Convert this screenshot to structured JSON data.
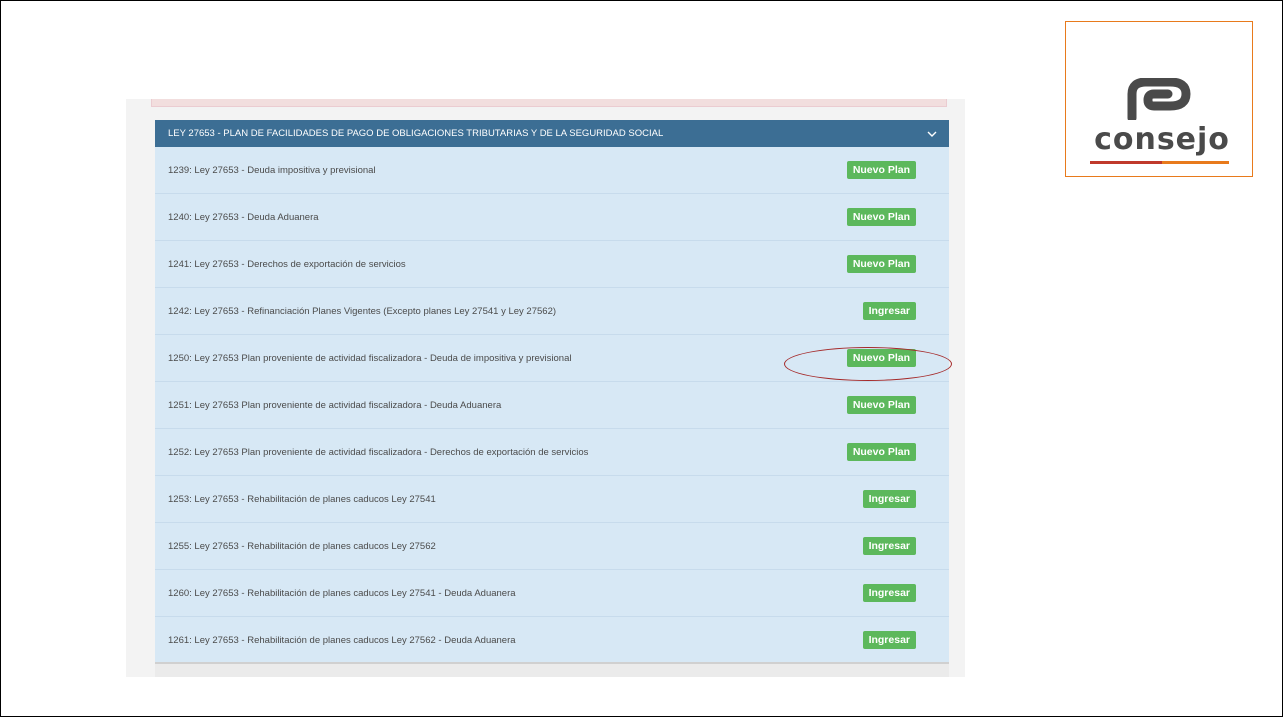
{
  "panel": {
    "title": "LEY 27653 - PLAN DE FACILIDADES DE PAGO DE OBLIGACIONES TRIBUTARIAS Y DE LA SEGURIDAD SOCIAL",
    "toggle_icon": "chevron-down-icon"
  },
  "rows": [
    {
      "label": "1239: Ley 27653 - Deuda impositiva y previsional",
      "action": "Nuevo Plan"
    },
    {
      "label": "1240: Ley 27653 - Deuda Aduanera",
      "action": "Nuevo Plan"
    },
    {
      "label": "1241: Ley 27653 - Derechos de exportación de servicios",
      "action": "Nuevo Plan"
    },
    {
      "label": "1242: Ley 27653 - Refinanciación Planes Vigentes (Excepto planes Ley 27541 y Ley 27562)",
      "action": "Ingresar"
    },
    {
      "label": "1250: Ley 27653 Plan proveniente de actividad fiscalizadora - Deuda de impositiva y previsional",
      "action": "Nuevo Plan"
    },
    {
      "label": "1251: Ley 27653 Plan proveniente de actividad fiscalizadora - Deuda Aduanera",
      "action": "Nuevo Plan"
    },
    {
      "label": "1252: Ley 27653 Plan proveniente de actividad fiscalizadora - Derechos de exportación de servicios",
      "action": "Nuevo Plan"
    },
    {
      "label": "1253: Ley 27653 - Rehabilitación de planes caducos Ley 27541",
      "action": "Ingresar"
    },
    {
      "label": "1255: Ley 27653 - Rehabilitación de planes caducos Ley 27562",
      "action": "Ingresar"
    },
    {
      "label": "1260: Ley 27653 - Rehabilitación de planes caducos Ley 27541 - Deuda Aduanera",
      "action": "Ingresar"
    },
    {
      "label": "1261: Ley 27653 - Rehabilitación de planes caducos Ley 27562 - Deuda Aduanera",
      "action": "Ingresar"
    }
  ],
  "logo": {
    "text": "consejo"
  },
  "colors": {
    "header_bg": "#3c6e94",
    "row_bg": "#d7e8f5",
    "badge_bg": "#5cb85c",
    "highlight": "#a52a2a",
    "logo_border": "#e87a1c"
  }
}
